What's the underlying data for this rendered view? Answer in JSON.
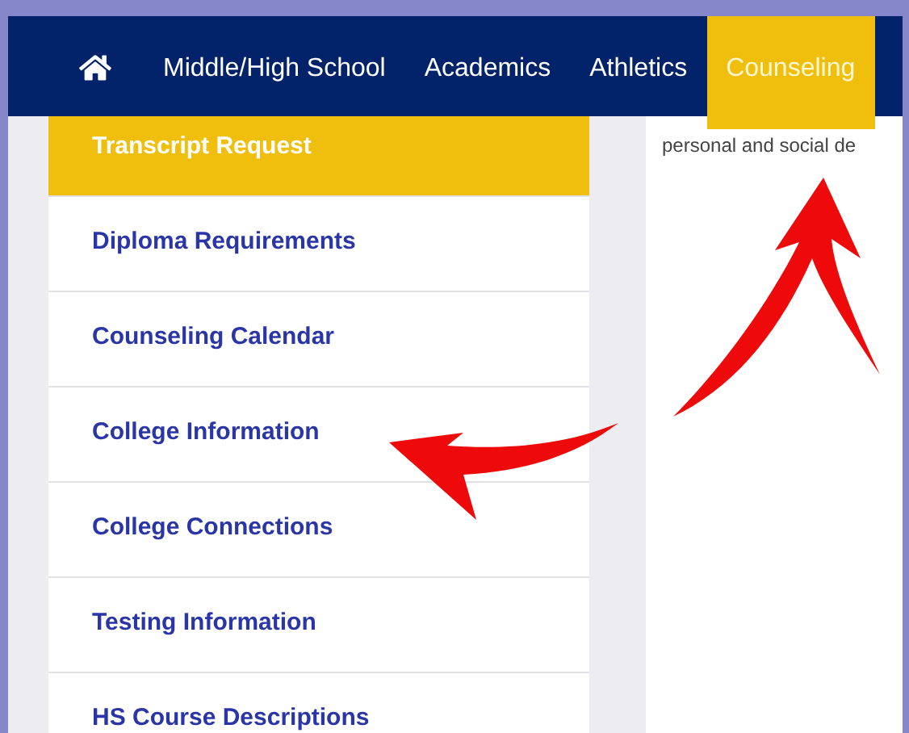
{
  "nav": {
    "items": [
      {
        "label": "Middle/High School",
        "selected": false
      },
      {
        "label": "Academics",
        "selected": false
      },
      {
        "label": "Athletics",
        "selected": false
      },
      {
        "label": "Counseling",
        "selected": true
      }
    ]
  },
  "sidebar": {
    "items": [
      {
        "label": "Transcript Request",
        "selected": true
      },
      {
        "label": "Diploma Requirements",
        "selected": false
      },
      {
        "label": "Counseling Calendar",
        "selected": false
      },
      {
        "label": "College Information",
        "selected": false
      },
      {
        "label": "College Connections",
        "selected": false
      },
      {
        "label": "Testing Information",
        "selected": false
      },
      {
        "label": "HS Course Descriptions",
        "selected": false
      }
    ]
  },
  "content": {
    "text": "personal and social de"
  }
}
